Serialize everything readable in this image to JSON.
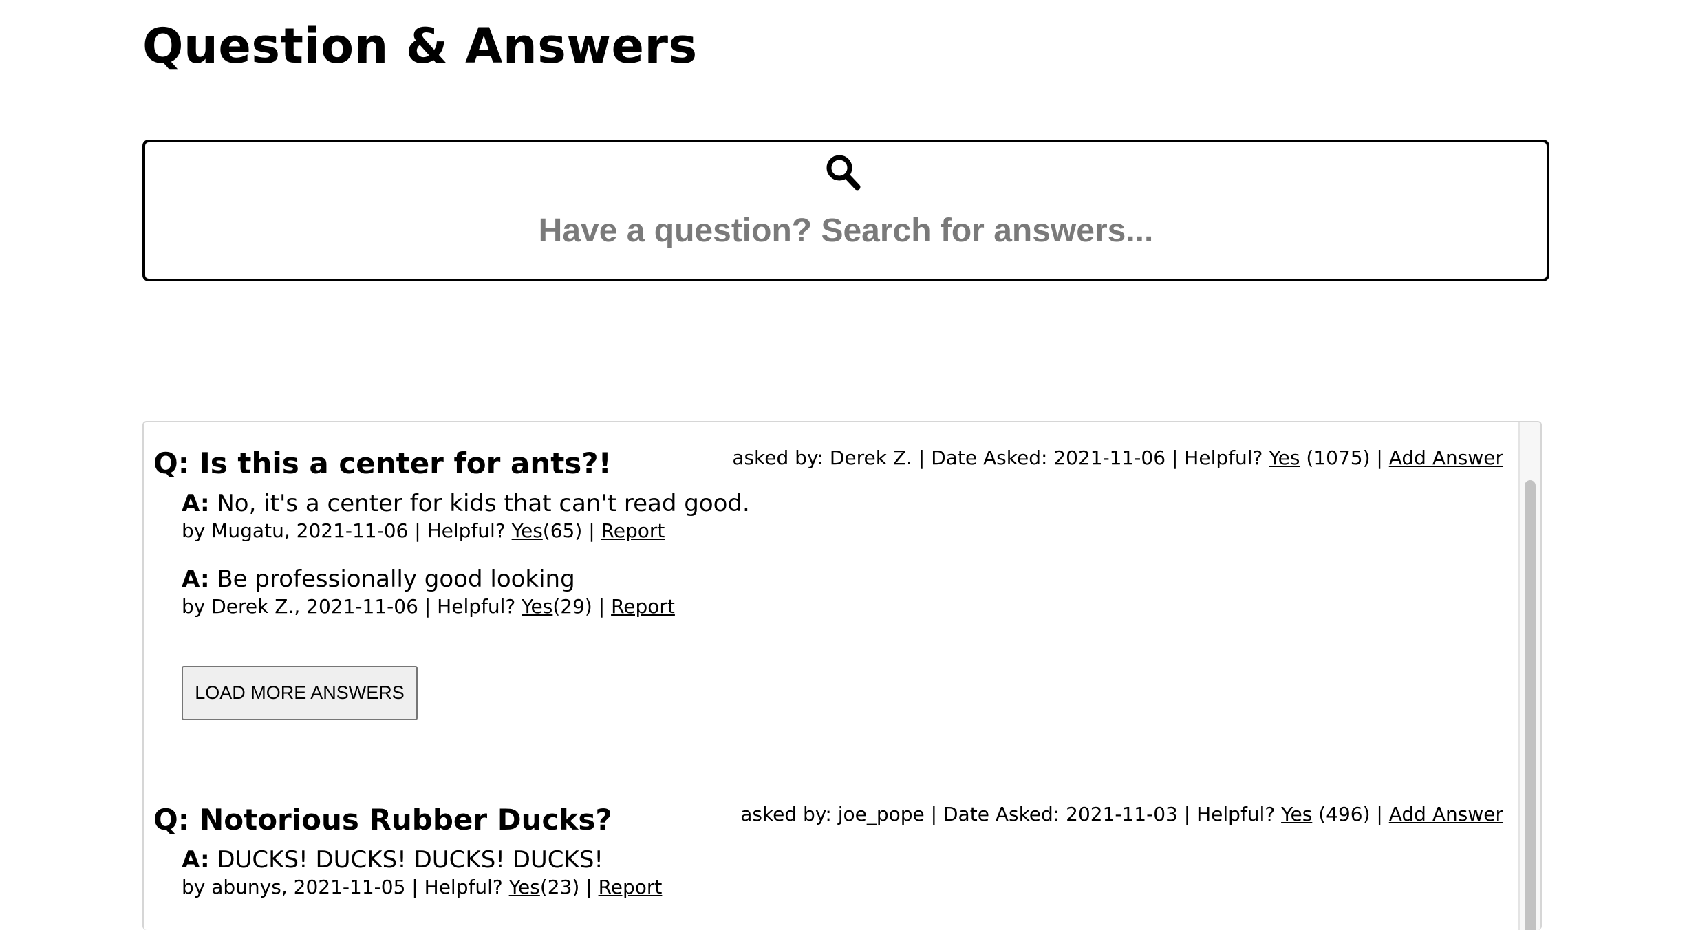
{
  "page": {
    "title": "Question & Answers"
  },
  "search": {
    "placeholder": "Have a question? Search for answers...",
    "icon": "search-icon"
  },
  "labels": {
    "asked_by": "asked by:",
    "date_asked": "Date Asked:",
    "helpful": "Helpful?",
    "yes": "Yes",
    "add_answer": "Add Answer",
    "report": "Report",
    "separator": "|",
    "question_prefix": "Q:",
    "answer_prefix": "A:",
    "by": "by",
    "load_more": "LOAD MORE ANSWERS"
  },
  "questions": [
    {
      "text": "Is this a center for ants?!",
      "asker": "Derek Z.",
      "date": "2021-11-06",
      "helpful_count": "(1075)",
      "answers": [
        {
          "text": "No, it's a center for kids that can't read good.",
          "author": "Mugatu",
          "date": "2021-11-06",
          "helpful_count": "(65)"
        },
        {
          "text": "Be professionally good looking",
          "author": "Derek Z.",
          "date": "2021-11-06",
          "helpful_count": "(29)"
        }
      ]
    },
    {
      "text": "Notorious Rubber Ducks?",
      "asker": "joe_pope",
      "date": "2021-11-03",
      "helpful_count": "(496)",
      "answers": [
        {
          "text": "DUCKS! DUCKS! DUCKS! DUCKS!",
          "author": "abunys",
          "date": "2021-11-05",
          "helpful_count": "(23)"
        }
      ]
    }
  ]
}
